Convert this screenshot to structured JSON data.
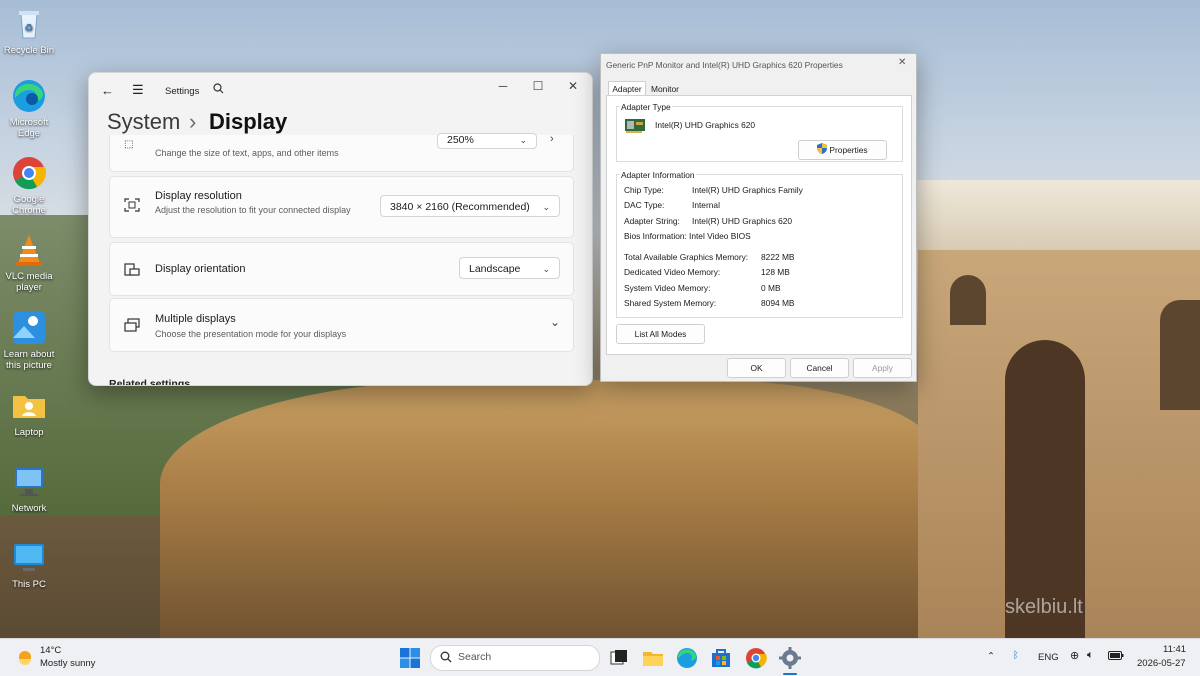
{
  "desktop": {
    "icons": [
      {
        "label": "Recycle Bin",
        "icon": "recycle-bin-icon"
      },
      {
        "label": "Microsoft Edge",
        "icon": "edge-icon"
      },
      {
        "label": "Google Chrome",
        "icon": "chrome-icon"
      },
      {
        "label": "VLC media player",
        "icon": "vlc-icon"
      },
      {
        "label": "Learn about this picture",
        "icon": "learn-picture-icon"
      },
      {
        "label": "Laptop",
        "icon": "user-folder-icon"
      },
      {
        "label": "Network",
        "icon": "network-icon"
      },
      {
        "label": "This PC",
        "icon": "this-pc-icon"
      }
    ]
  },
  "settings": {
    "app_title": "Settings",
    "breadcrumb_parent": "System",
    "breadcrumb_sep": "›",
    "page_title": "Display",
    "scale_row": {
      "subtitle": "Change the size of text, apps, and other items",
      "value": "250%"
    },
    "resolution_row": {
      "title": "Display resolution",
      "subtitle": "Adjust the resolution to fit your connected display",
      "value": "3840 × 2160 (Recommended)"
    },
    "orientation_row": {
      "title": "Display orientation",
      "value": "Landscape"
    },
    "multiple_row": {
      "title": "Multiple displays",
      "subtitle": "Choose the presentation mode for your displays"
    },
    "related_heading": "Related settings"
  },
  "props_dialog": {
    "title": "Generic PnP Monitor and Intel(R) UHD Graphics 620 Properties",
    "tabs": [
      "Adapter",
      "Monitor"
    ],
    "adapter_type_heading": "Adapter Type",
    "adapter_name": "Intel(R) UHD Graphics 620",
    "properties_button": "Properties",
    "adapter_info_heading": "Adapter Information",
    "info": [
      {
        "label": "Chip Type:",
        "value": "Intel(R) UHD Graphics Family"
      },
      {
        "label": "DAC Type:",
        "value": "Internal"
      },
      {
        "label": "Adapter String:",
        "value": "Intel(R) UHD Graphics 620"
      },
      {
        "label": "Bios Information:",
        "value": "Intel Video BIOS"
      }
    ],
    "memory": [
      {
        "label": "Total Available Graphics Memory:",
        "value": "8222 MB"
      },
      {
        "label": "Dedicated Video Memory:",
        "value": "128 MB"
      },
      {
        "label": "System Video Memory:",
        "value": "0 MB"
      },
      {
        "label": "Shared System Memory:",
        "value": "8094 MB"
      }
    ],
    "list_modes_button": "List All Modes",
    "ok_button": "OK",
    "cancel_button": "Cancel",
    "apply_button": "Apply"
  },
  "taskbar": {
    "weather_temp": "14°C",
    "weather_desc": "Mostly sunny",
    "search_placeholder": "Search",
    "language": "ENG",
    "time": "11:41",
    "date": "2026-05-27"
  },
  "watermark": "skelbiu.lt"
}
